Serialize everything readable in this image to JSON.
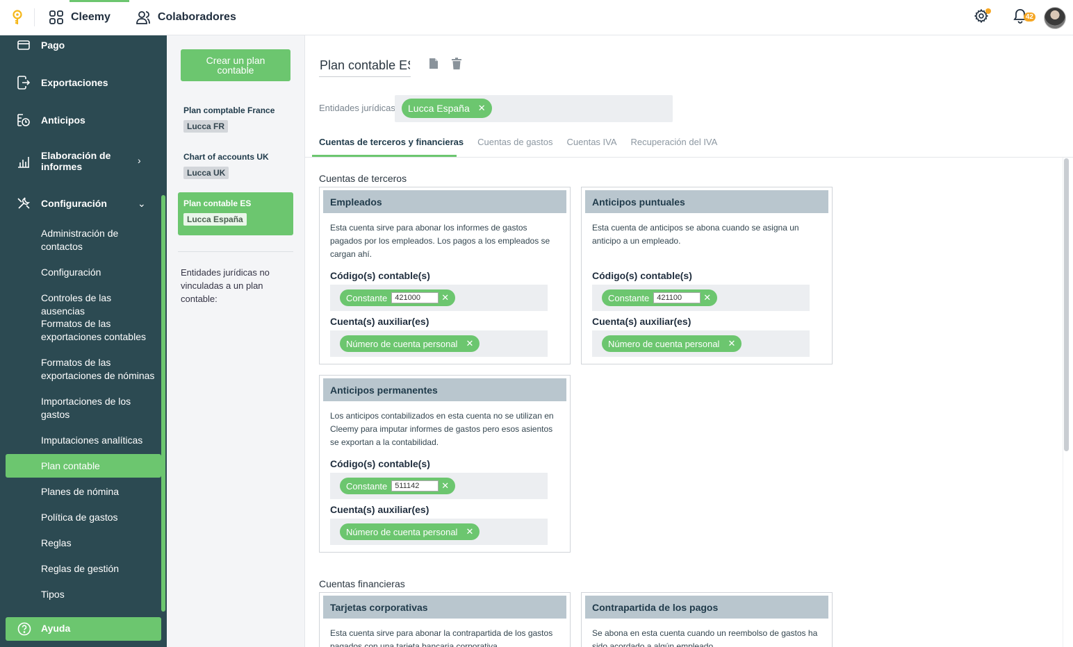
{
  "topbar": {
    "app_name": "Cleemy",
    "people_label": "Colaboradores",
    "notification_count": "42",
    "colors": {
      "accent": "#6cc66f",
      "warning": "#f5a623"
    }
  },
  "sidebar": {
    "items": [
      {
        "label": "Pago",
        "icon": "credit-card-icon"
      },
      {
        "label": "Exportaciones",
        "icon": "export-icon"
      },
      {
        "label": "Anticipos",
        "icon": "advance-icon"
      },
      {
        "label": "Elaboración de informes",
        "icon": "chart-icon"
      },
      {
        "label": "Configuración",
        "icon": "wrench-icon"
      }
    ],
    "sub_items": [
      "Administración de contactos",
      "Configuración",
      "Controles de las ausencias",
      "Formatos de las exportaciones contables",
      "Formatos de las exportaciones de nóminas",
      "Importaciones de los gastos",
      "Imputaciones analíticas",
      "Plan contable",
      "Planes de nómina",
      "Política de gastos",
      "Reglas",
      "Reglas de gestión",
      "Tipos"
    ],
    "active_sub": "Plan contable",
    "help_label": "Ayuda",
    "color": "#2c4a52"
  },
  "plans": {
    "create_label": "Crear un plan contable",
    "list": [
      {
        "name": "Plan comptable France",
        "entity": "Lucca FR"
      },
      {
        "name": "Chart of accounts UK",
        "entity": "Lucca UK"
      },
      {
        "name": "Plan contable ES",
        "entity": "Lucca España"
      }
    ],
    "active": "Plan contable ES",
    "unlinked_text": "Entidades jurídicas no vinculadas a un plan contable:"
  },
  "main": {
    "plan_title": "Plan contable ES",
    "entities_label": "Entidades jurídicas:",
    "entities": [
      "Lucca España"
    ],
    "tabs": [
      "Cuentas de terceros y financieras",
      "Cuentas de gastos",
      "Cuentas IVA",
      "Recuperación del IVA"
    ],
    "active_tab": "Cuentas de terceros y financieras",
    "third_party_title": "Cuentas de terceros",
    "financial_title": "Cuentas financieras",
    "code_label": "Código(s) contable(s)",
    "aux_label": "Cuenta(s) auxiliar(es)",
    "constant_label": "Constante",
    "personal_account_label": "Número de cuenta personal",
    "cards": [
      {
        "title": "Empleados",
        "desc": "Esta cuenta sirve para abonar los informes de gastos pagados por los empleados. Los pagos a los empleados se cargan ahí.",
        "code": "421000"
      },
      {
        "title": "Anticipos puntuales",
        "desc": "Esta cuenta de anticipos se abona cuando se asigna un anticipo a un empleado.",
        "code": "421100"
      },
      {
        "title": "Anticipos permanentes",
        "desc": "Los anticipos contabilizados en esta cuenta no se utilizan en Cleemy para imputar informes de gastos pero esos asientos se exportan a la contabilidad.",
        "code": "511142"
      }
    ],
    "financial_cards": [
      {
        "title": "Tarjetas corporativas",
        "desc": "Esta cuenta sirve para abonar la contrapartida de los gastos pagados con una tarjeta bancaria corporativa."
      },
      {
        "title": "Contrapartida de los pagos",
        "desc": "Se abona en esta cuenta cuando un reembolso de gastos ha sido acordado a algún empleado."
      }
    ]
  }
}
